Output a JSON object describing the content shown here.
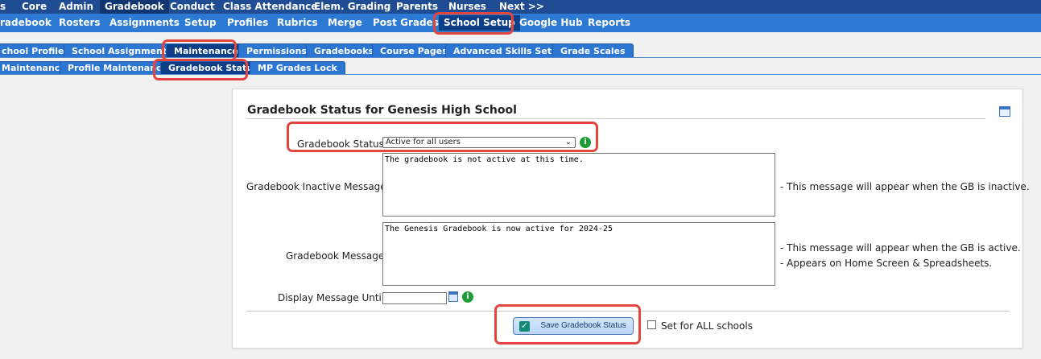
{
  "top_nav": [
    "s",
    "Core",
    "Admin",
    "Gradebook",
    "Conduct",
    "Class Attendance",
    "Elem. Grading",
    "Parents",
    "Nurses",
    "Next >>"
  ],
  "second_nav": [
    "radebook",
    "Rosters",
    "Assignments",
    "Setup",
    "Profiles",
    "Rubrics",
    "Merge",
    "Post Grades",
    "School Setup",
    "Google Hub",
    "Reports"
  ],
  "tabs_primary": [
    "chool Profiles",
    "School Assignments",
    "Maintenance",
    "Permissions",
    "Gradebooks",
    "Course Pages",
    "Advanced Skills Setup",
    "Grade Scales"
  ],
  "tabs_secondary": [
    "Maintenance",
    "Profile Maintenance",
    "Gradebook Status",
    "MP Grades Lock"
  ],
  "panel": {
    "title": "Gradebook Status for Genesis High School",
    "status_label": "Gradebook Status:",
    "status_value": "Active for all users",
    "inactive_label": "Gradebook Inactive Message:",
    "inactive_message": "The gradebook is not active at this time.",
    "inactive_hint": "- This message will appear when the GB is inactive.",
    "message_label": "Gradebook Message:",
    "message_value": "The Genesis Gradebook is now active for 2024-25",
    "message_hint_1": "- This message will appear when the GB is active.",
    "message_hint_2": "- Appears on Home Screen & Spreadsheets.",
    "display_until_label": "Display Message Until:",
    "display_until_value": "",
    "save_label": "Save Gradebook Status",
    "set_all_label": "Set for ALL schools"
  },
  "icons": {
    "calendar": "calendar-icon",
    "info": "info-icon",
    "dropdown": "chevron-down-icon",
    "check": "check-icon"
  },
  "colors": {
    "top_nav": "#1f4c93",
    "second_nav": "#2d7ad4",
    "tab": "#2b76d3",
    "active_tab": "#0d3f88",
    "highlight": "#e3453f",
    "info": "#1f9b37"
  }
}
